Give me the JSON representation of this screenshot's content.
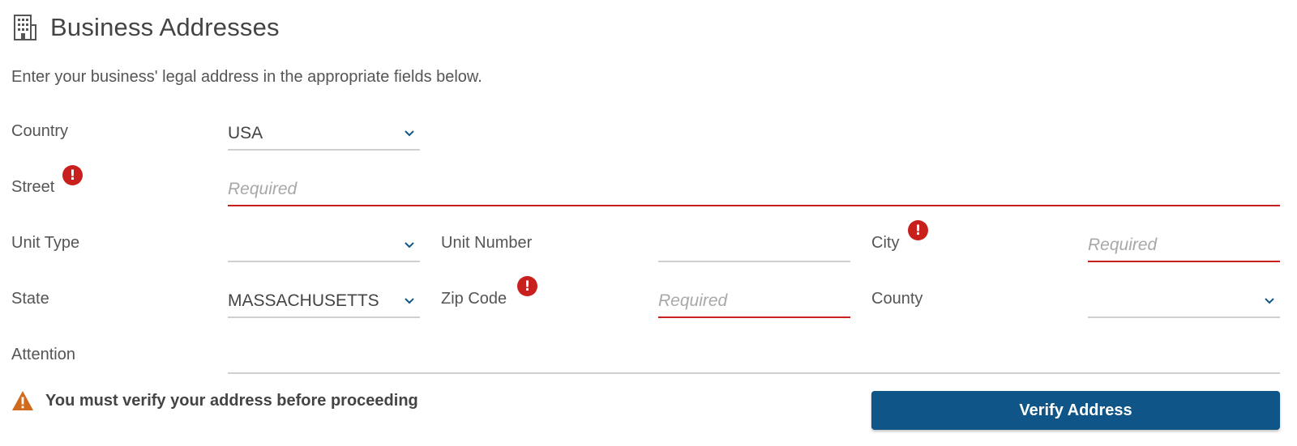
{
  "header": {
    "title": "Business Addresses",
    "icon": "building-icon"
  },
  "intro": "Enter your business' legal address in the appropriate fields below.",
  "colors": {
    "error": "#c8201d",
    "primary": "#105587",
    "warning": "#d26a1e"
  },
  "form": {
    "country": {
      "label": "Country",
      "value": "USA"
    },
    "street": {
      "label": "Street",
      "placeholder": "Required",
      "error_mark": "!"
    },
    "unit_type": {
      "label": "Unit Type",
      "value": ""
    },
    "unit_number": {
      "label": "Unit Number",
      "value": ""
    },
    "city": {
      "label": "City",
      "placeholder": "Required",
      "error_mark": "!"
    },
    "state": {
      "label": "State",
      "value": "MASSACHUSETTS"
    },
    "zip_code": {
      "label": "Zip Code",
      "placeholder": "Required",
      "error_mark": "!"
    },
    "county": {
      "label": "County",
      "value": ""
    },
    "attention": {
      "label": "Attention",
      "value": ""
    }
  },
  "warning": {
    "text": "You must verify your address before proceeding",
    "icon": "warning-icon"
  },
  "verify_button": {
    "label": "Verify Address"
  }
}
